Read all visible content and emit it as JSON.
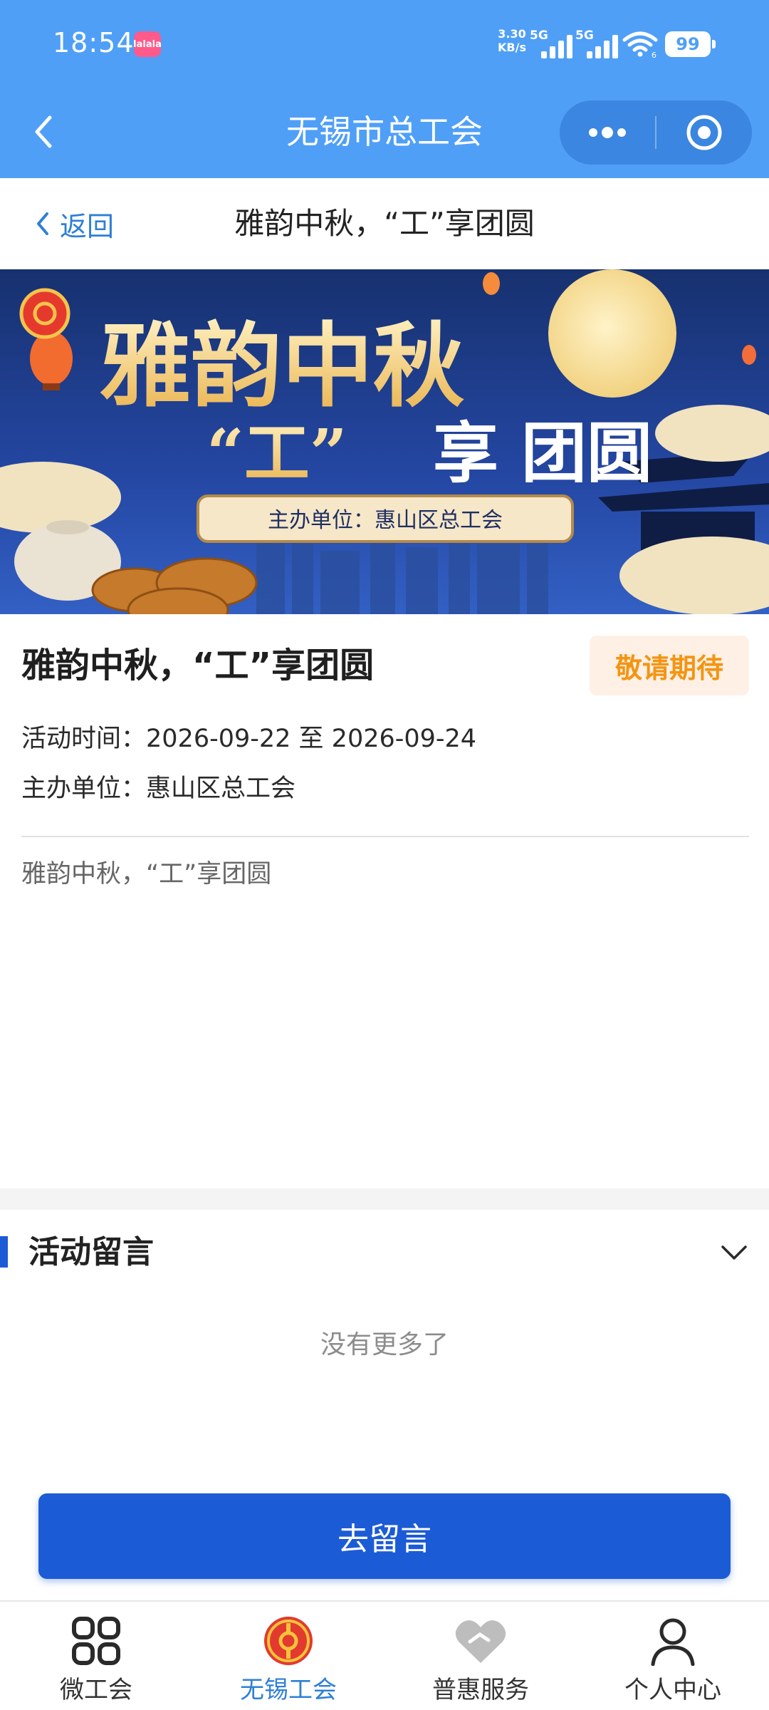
{
  "status_bar": {
    "time": "18:54",
    "app_badge": "lalala",
    "net_speed_value": "3.30",
    "net_speed_unit": "KB/s",
    "sim1_label": "5G",
    "sim2_label": "5G",
    "wifi_label": "6",
    "battery": "99"
  },
  "mini_program": {
    "title": "无锡市总工会",
    "menu_icon": "more-dots-icon",
    "close_icon": "target-circle-icon"
  },
  "page_nav": {
    "back_label": "返回",
    "title": "雅韵中秋，“工”享团圆"
  },
  "banner": {
    "headline_line1": "雅韵中秋",
    "headline_line2_quote": "“工”",
    "headline_line2_rest": "享 团圆",
    "organizer_plate": "主办单位：惠山区总工会",
    "accent_color": "#f2c46b",
    "sky_color": "#1d3a8a"
  },
  "activity": {
    "title": "雅韵中秋，“工”享团圆",
    "status": "敬请期待",
    "time_label": "活动时间：",
    "time_value": "2026-09-22 至 2026-09-24",
    "organizer_label": "主办单位：",
    "organizer_value": "惠山区总工会",
    "description": "雅韵中秋，“工”享团圆"
  },
  "comments": {
    "section_title": "活动留言",
    "empty_text": "没有更多了",
    "button_label": "去留言"
  },
  "tabbar": {
    "items": [
      {
        "label": "微工会",
        "icon": "grid-icon"
      },
      {
        "label": "无锡工会",
        "icon": "union-emblem-icon"
      },
      {
        "label": "普惠服务",
        "icon": "heart-handshake-icon"
      },
      {
        "label": "个人中心",
        "icon": "person-icon"
      }
    ],
    "active_index": 1
  },
  "colors": {
    "header_blue": "#4f9ff7",
    "primary_blue": "#1c5bd6",
    "link_blue": "#2f7fd6",
    "status_orange": "#f39512",
    "status_bg": "#fff0e5"
  }
}
